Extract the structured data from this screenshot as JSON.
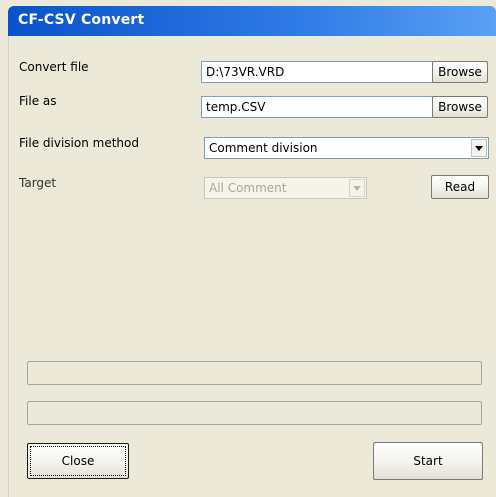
{
  "window": {
    "title": "CF-CSV Convert"
  },
  "form": {
    "convert_file": {
      "label": "Convert file",
      "value": "D:\\73VR.VRD",
      "browse_label": "Browse"
    },
    "file_as": {
      "label": "File as",
      "value": "temp.CSV",
      "browse_label": "Browse"
    },
    "division_method": {
      "label": "File division method",
      "selected": "Comment division"
    },
    "target": {
      "label": "Target",
      "selected": "All Comment",
      "read_label": "Read"
    }
  },
  "progress": {
    "bar1": 0,
    "bar2": 0
  },
  "footer": {
    "close_label": "Close",
    "start_label": "Start"
  },
  "colors": {
    "titlebar": "#0a52c9",
    "window_bg": "#ece9d8",
    "input_border": "#7f9db9"
  },
  "icons": {
    "dropdown": "chevron-down-icon"
  }
}
